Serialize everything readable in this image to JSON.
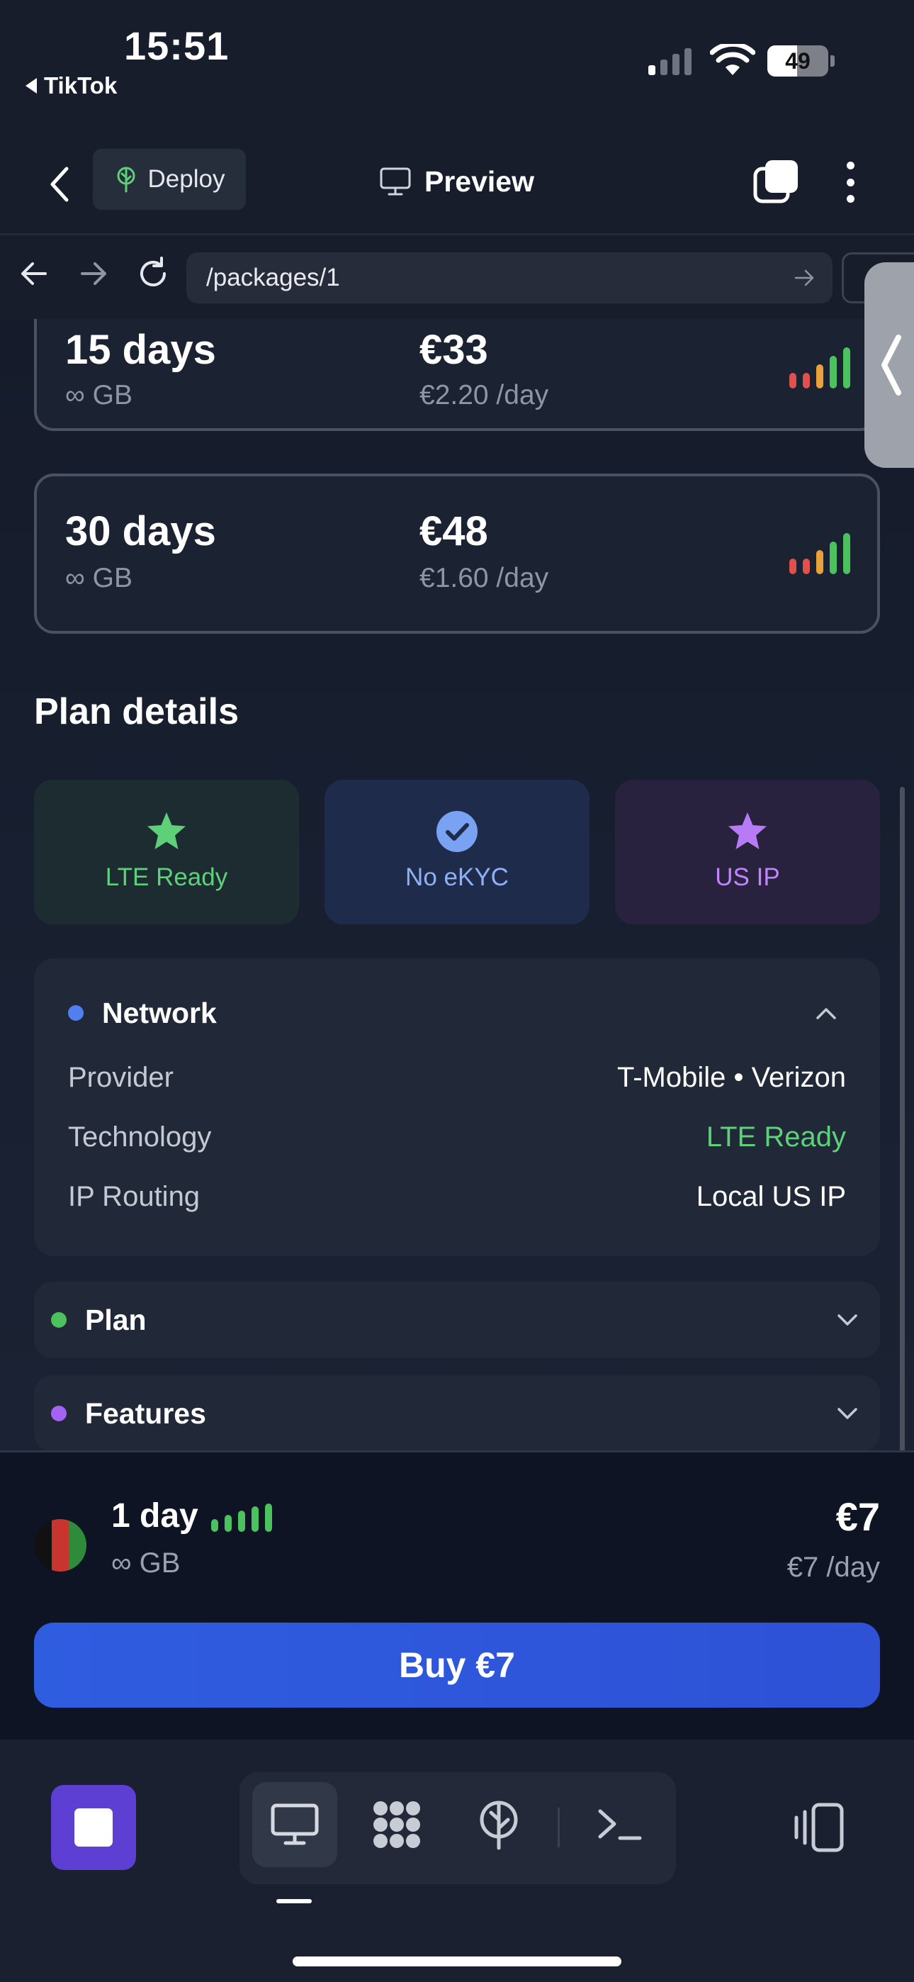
{
  "status_bar": {
    "time": "15:51",
    "back_app": "TikTok",
    "battery": "49",
    "battery_level_pct": 49
  },
  "header": {
    "deploy_label": "Deploy",
    "preview_label": "Preview"
  },
  "browser": {
    "url": "/packages/1"
  },
  "packages": [
    {
      "days": "15 days",
      "data": "∞ GB",
      "price": "€33",
      "per_day": "€2.20 /day"
    },
    {
      "days": "30 days",
      "data": "∞ GB",
      "price": "€48",
      "per_day": "€1.60 /day"
    }
  ],
  "plan_details": {
    "title": "Plan details",
    "badges": [
      {
        "label": "LTE Ready",
        "icon": "star-icon",
        "color": "#5fd07a"
      },
      {
        "label": "No eKYC",
        "icon": "check-circle-icon",
        "color": "#8fb0f5"
      },
      {
        "label": "US IP",
        "icon": "star-icon",
        "color": "#c084fc"
      }
    ],
    "network": {
      "title": "Network",
      "dot_color": "#4f7ff0",
      "rows": [
        {
          "key": "Provider",
          "value": "T-Mobile • Verizon"
        },
        {
          "key": "Technology",
          "value": "LTE Ready"
        },
        {
          "key": "IP Routing",
          "value": "Local US IP"
        }
      ]
    },
    "plan": {
      "title": "Plan",
      "dot_color": "#4bc25d"
    },
    "features": {
      "title": "Features",
      "dot_color": "#a463f2"
    }
  },
  "selected": {
    "days": "1 day",
    "data": "∞ GB",
    "price": "€7",
    "per_day": "€7 /day",
    "buy_label": "Buy €7"
  },
  "colors": {
    "accent": "#2f5de0",
    "stop": "#5d3fd3",
    "signal_red": "#e0514e",
    "signal_orange": "#e9a23b",
    "signal_green": "#4bc25d"
  }
}
